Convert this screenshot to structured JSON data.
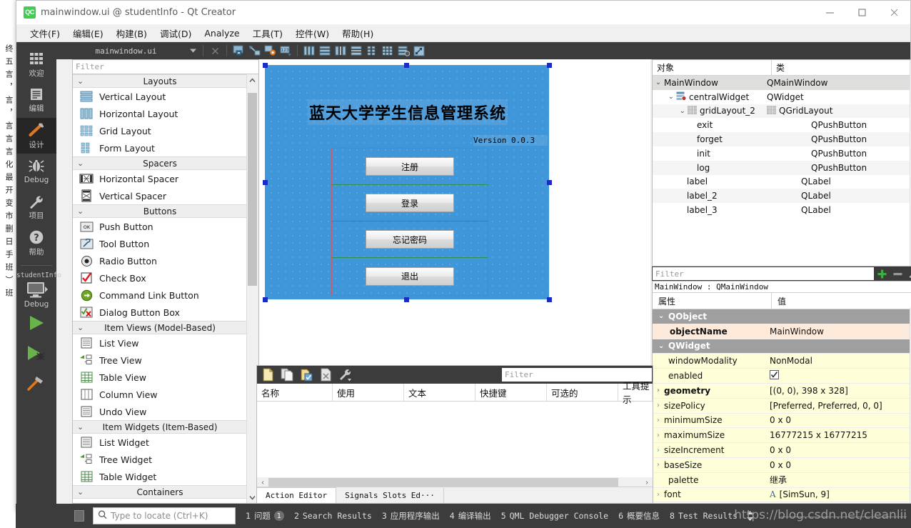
{
  "window": {
    "title": "mainwindow.ui @ studentInfo - Qt Creator",
    "logo": "QC",
    "minimize_icon": "minimize-icon",
    "maximize_icon": "maximize-icon",
    "close_icon": "close-icon"
  },
  "menubar": {
    "items": [
      {
        "label": "文件(F)"
      },
      {
        "label": "编辑(E)"
      },
      {
        "label": "构建(B)"
      },
      {
        "label": "调试(D)"
      },
      {
        "label": "Analyze"
      },
      {
        "label": "工具(T)"
      },
      {
        "label": "控件(W)"
      },
      {
        "label": "帮助(H)"
      }
    ]
  },
  "modebar": {
    "modes": [
      {
        "label": "欢迎",
        "icon": "grid-squares-icon",
        "selected": false
      },
      {
        "label": "编辑",
        "icon": "document-lines-icon",
        "selected": false
      },
      {
        "label": "设计",
        "icon": "pencil-icon",
        "selected": true
      },
      {
        "label": "Debug",
        "icon": "bug-icon",
        "selected": false
      },
      {
        "label": "项目",
        "icon": "wrench-icon",
        "selected": false
      },
      {
        "label": "帮助",
        "icon": "question-circle-icon",
        "selected": false
      }
    ],
    "kit": {
      "project": "studentInfo",
      "build_config": "Debug",
      "icon": "monitor-icon"
    },
    "actions": [
      {
        "name": "run-button",
        "icon": "play-triangle-icon"
      },
      {
        "name": "debug-button",
        "icon": "play-bug-icon"
      },
      {
        "name": "build-button",
        "icon": "hammer-icon"
      }
    ]
  },
  "designer_toolbar": {
    "file_name": "mainwindow.ui",
    "dropdown_icon": "chevron-down-icon",
    "close_icon": "close-x-icon",
    "tools": [
      {
        "name": "edit-widgets-tool",
        "icon": "edit-widgets-icon"
      },
      {
        "name": "edit-signals-slots-tool",
        "icon": "signals-slots-icon"
      },
      {
        "name": "edit-buddies-tool",
        "icon": "buddies-icon"
      },
      {
        "name": "edit-tab-order-tool",
        "icon": "tab-order-icon"
      },
      {
        "name": "layout-horizontally-tool",
        "icon": "layout-horizontal-icon"
      },
      {
        "name": "layout-vertically-tool",
        "icon": "layout-vertical-icon"
      },
      {
        "name": "layout-splitter-horizontal-tool",
        "icon": "splitter-h-icon"
      },
      {
        "name": "layout-splitter-vertical-tool",
        "icon": "splitter-v-icon"
      },
      {
        "name": "layout-form-tool",
        "icon": "form-layout-icon"
      },
      {
        "name": "layout-grid-tool",
        "icon": "grid-layout-icon"
      },
      {
        "name": "break-layout-tool",
        "icon": "break-layout-icon"
      },
      {
        "name": "adjust-size-tool",
        "icon": "adjust-size-icon"
      }
    ]
  },
  "widget_box": {
    "filter_placeholder": "Filter",
    "chevron": "⌄",
    "categories": [
      {
        "title": "Layouts",
        "items": [
          {
            "label": "Vertical Layout",
            "icon": "vertical-layout-icon"
          },
          {
            "label": "Horizontal Layout",
            "icon": "horizontal-layout-icon"
          },
          {
            "label": "Grid Layout",
            "icon": "grid-layout-icon"
          },
          {
            "label": "Form Layout",
            "icon": "form-layout-icon"
          }
        ]
      },
      {
        "title": "Spacers",
        "items": [
          {
            "label": "Horizontal Spacer",
            "icon": "horizontal-spacer-icon"
          },
          {
            "label": "Vertical Spacer",
            "icon": "vertical-spacer-icon"
          }
        ]
      },
      {
        "title": "Buttons",
        "items": [
          {
            "label": "Push Button",
            "icon": "push-button-icon"
          },
          {
            "label": "Tool Button",
            "icon": "tool-button-icon"
          },
          {
            "label": "Radio Button",
            "icon": "radio-button-icon"
          },
          {
            "label": "Check Box",
            "icon": "check-box-icon"
          },
          {
            "label": "Command Link Button",
            "icon": "command-link-icon"
          },
          {
            "label": "Dialog Button Box",
            "icon": "dialog-button-box-icon"
          }
        ]
      },
      {
        "title": "Item Views (Model-Based)",
        "items": [
          {
            "label": "List View",
            "icon": "list-view-icon"
          },
          {
            "label": "Tree View",
            "icon": "tree-view-icon"
          },
          {
            "label": "Table View",
            "icon": "table-view-icon"
          },
          {
            "label": "Column View",
            "icon": "column-view-icon"
          },
          {
            "label": "Undo View",
            "icon": "undo-view-icon"
          }
        ]
      },
      {
        "title": "Item Widgets (Item-Based)",
        "items": [
          {
            "label": "List Widget",
            "icon": "list-widget-icon"
          },
          {
            "label": "Tree Widget",
            "icon": "tree-widget-icon"
          },
          {
            "label": "Table Widget",
            "icon": "table-widget-icon"
          }
        ]
      },
      {
        "title": "Containers",
        "items": []
      }
    ]
  },
  "form": {
    "title_label": "蓝天大学学生信息管理系统",
    "version_label": "Version 0.0.3",
    "background_color": "#3f96d9",
    "buttons": [
      {
        "label": "注册",
        "object": "init"
      },
      {
        "label": "登录",
        "object": "log"
      },
      {
        "label": "忘记密码",
        "object": "forget"
      },
      {
        "label": "退出",
        "object": "exit"
      }
    ],
    "geometry_label": "398 x 328"
  },
  "object_inspector": {
    "columns": [
      "对象",
      "类"
    ],
    "rows": [
      {
        "name": "MainWindow",
        "class": "QMainWindow",
        "indent": 0,
        "expander": "⌄",
        "icon": "",
        "selected": true
      },
      {
        "name": "centralWidget",
        "class": "QWidget",
        "indent": 1,
        "expander": "⌄",
        "icon": "central-widget-icon",
        "selected": false
      },
      {
        "name": "gridLayout_2",
        "class": "QGridLayout",
        "indent": 2,
        "expander": "⌄",
        "icon": "grid-layout-icon",
        "selected": false
      },
      {
        "name": "exit",
        "class": "QPushButton",
        "indent": 3,
        "expander": "",
        "icon": "",
        "selected": false
      },
      {
        "name": "forget",
        "class": "QPushButton",
        "indent": 3,
        "expander": "",
        "icon": "",
        "selected": false
      },
      {
        "name": "init",
        "class": "QPushButton",
        "indent": 3,
        "expander": "",
        "icon": "",
        "selected": false
      },
      {
        "name": "log",
        "class": "QPushButton",
        "indent": 3,
        "expander": "",
        "icon": "",
        "selected": false
      },
      {
        "name": "label",
        "class": "QLabel",
        "indent": 2,
        "expander": "",
        "icon": "",
        "selected": false
      },
      {
        "name": "label_2",
        "class": "QLabel",
        "indent": 2,
        "expander": "",
        "icon": "",
        "selected": false
      },
      {
        "name": "label_3",
        "class": "QLabel",
        "indent": 2,
        "expander": "",
        "icon": "",
        "selected": false
      }
    ]
  },
  "property_filter": {
    "placeholder": "Filter",
    "add_icon": "plus-icon",
    "remove_icon": "minus-icon",
    "configure_icon": "wrench-icon"
  },
  "property_editor": {
    "object_header": "MainWindow : QMainWindow",
    "columns": [
      "属性",
      "值"
    ],
    "rows": [
      {
        "key": "QObject",
        "value": "",
        "kind": "group",
        "expander": "⌄"
      },
      {
        "key": "objectName",
        "value": "MainWindow",
        "kind": "peach",
        "expander": ""
      },
      {
        "key": "QWidget",
        "value": "",
        "kind": "group",
        "expander": "⌄"
      },
      {
        "key": "windowModality",
        "value": "NonModal",
        "kind": "yellow",
        "expander": ""
      },
      {
        "key": "enabled",
        "value": "☑",
        "kind": "yellow",
        "expander": "",
        "is_checkbox": true
      },
      {
        "key": "geometry",
        "value": "[(0, 0), 398 x 328]",
        "kind": "yellow bold",
        "expander": "›"
      },
      {
        "key": "sizePolicy",
        "value": "[Preferred, Preferred, 0, 0]",
        "kind": "yellow",
        "expander": "›"
      },
      {
        "key": "minimumSize",
        "value": "0 x 0",
        "kind": "yellow",
        "expander": "›"
      },
      {
        "key": "maximumSize",
        "value": "16777215 x 16777215",
        "kind": "yellow",
        "expander": "›"
      },
      {
        "key": "sizeIncrement",
        "value": "0 x 0",
        "kind": "yellow",
        "expander": "›"
      },
      {
        "key": "baseSize",
        "value": "0 x 0",
        "kind": "yellow",
        "expander": "›"
      },
      {
        "key": "palette",
        "value": "继承",
        "kind": "yellow",
        "expander": ""
      },
      {
        "key": "font",
        "value": "[SimSun, 9]",
        "kind": "yellow",
        "expander": "›"
      }
    ]
  },
  "action_editor": {
    "toolbar_buttons": [
      {
        "name": "new-action-button",
        "icon": "new-file-icon"
      },
      {
        "name": "copy-action-button",
        "icon": "copy-icon"
      },
      {
        "name": "paste-action-button",
        "icon": "paste-icon"
      },
      {
        "name": "delete-action-button",
        "icon": "delete-x-icon"
      },
      {
        "name": "configure-action-button",
        "icon": "wrench-icon"
      }
    ],
    "filter_placeholder": "Filter",
    "columns": [
      "名称",
      "使用",
      "文本",
      "快捷键",
      "可选的",
      "工具提示"
    ],
    "rows": [],
    "tabs": [
      {
        "label": "Action Editor",
        "active": true
      },
      {
        "label": "Signals  Slots Ed···",
        "active": false
      }
    ]
  },
  "status_bar": {
    "locator_placeholder": "Type to locate (Ctrl+K)",
    "search_icon": "search-icon",
    "panes": [
      {
        "num": "1",
        "label": "问题",
        "badge": "1"
      },
      {
        "num": "2",
        "label": "Search Results",
        "badge": ""
      },
      {
        "num": "3",
        "label": "应用程序输出",
        "badge": ""
      },
      {
        "num": "4",
        "label": "编译输出",
        "badge": ""
      },
      {
        "num": "5",
        "label": "QML Debugger Console",
        "badge": ""
      },
      {
        "num": "6",
        "label": "概要信息",
        "badge": ""
      },
      {
        "num": "8",
        "label": "Test Results",
        "badge": ""
      }
    ],
    "updown_icon": "up-down-arrows-icon",
    "watermark": "https://blog.csdn.net/cleanlii"
  },
  "background_window": {
    "vertical_text": "终五言，言，言言言化最开变市删日手班）班"
  }
}
